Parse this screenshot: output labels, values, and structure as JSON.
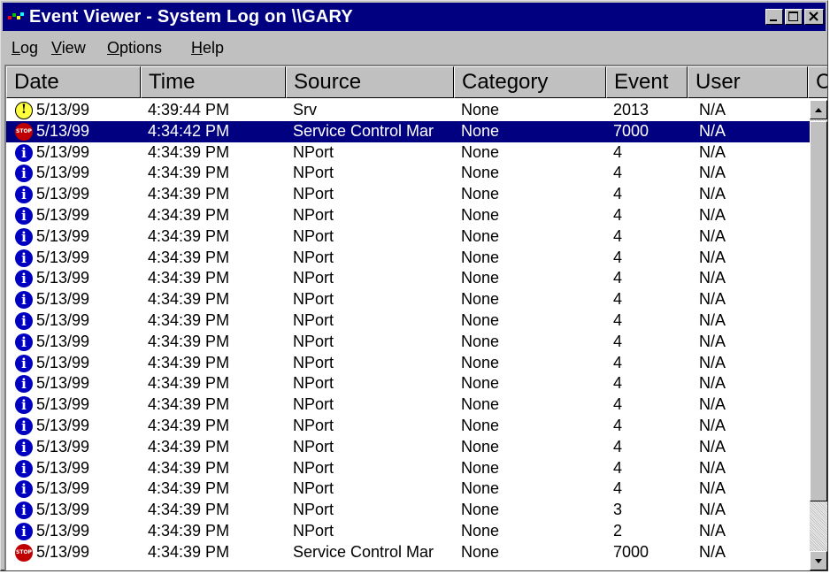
{
  "window": {
    "title": "Event Viewer - System Log on \\\\GARY"
  },
  "menu": [
    "Log",
    "View",
    "Options",
    "Help"
  ],
  "columns": [
    "Date",
    "Time",
    "Source",
    "Category",
    "Event",
    "User",
    "C"
  ],
  "rows": [
    {
      "icon": "warning-icon",
      "date": "5/13/99",
      "time": "4:39:44 PM",
      "source": "Srv",
      "category": "None",
      "event": "2013",
      "user": "N/A"
    },
    {
      "icon": "error-icon",
      "date": "5/13/99",
      "time": "4:34:42 PM",
      "source": "Service Control Mar",
      "category": "None",
      "event": "7000",
      "user": "N/A",
      "selected": true
    },
    {
      "icon": "info-icon",
      "date": "5/13/99",
      "time": "4:34:39 PM",
      "source": "NPort",
      "category": "None",
      "event": "4",
      "user": "N/A"
    },
    {
      "icon": "info-icon",
      "date": "5/13/99",
      "time": "4:34:39 PM",
      "source": "NPort",
      "category": "None",
      "event": "4",
      "user": "N/A"
    },
    {
      "icon": "info-icon",
      "date": "5/13/99",
      "time": "4:34:39 PM",
      "source": "NPort",
      "category": "None",
      "event": "4",
      "user": "N/A"
    },
    {
      "icon": "info-icon",
      "date": "5/13/99",
      "time": "4:34:39 PM",
      "source": "NPort",
      "category": "None",
      "event": "4",
      "user": "N/A"
    },
    {
      "icon": "info-icon",
      "date": "5/13/99",
      "time": "4:34:39 PM",
      "source": "NPort",
      "category": "None",
      "event": "4",
      "user": "N/A"
    },
    {
      "icon": "info-icon",
      "date": "5/13/99",
      "time": "4:34:39 PM",
      "source": "NPort",
      "category": "None",
      "event": "4",
      "user": "N/A"
    },
    {
      "icon": "info-icon",
      "date": "5/13/99",
      "time": "4:34:39 PM",
      "source": "NPort",
      "category": "None",
      "event": "4",
      "user": "N/A"
    },
    {
      "icon": "info-icon",
      "date": "5/13/99",
      "time": "4:34:39 PM",
      "source": "NPort",
      "category": "None",
      "event": "4",
      "user": "N/A"
    },
    {
      "icon": "info-icon",
      "date": "5/13/99",
      "time": "4:34:39 PM",
      "source": "NPort",
      "category": "None",
      "event": "4",
      "user": "N/A"
    },
    {
      "icon": "info-icon",
      "date": "5/13/99",
      "time": "4:34:39 PM",
      "source": "NPort",
      "category": "None",
      "event": "4",
      "user": "N/A"
    },
    {
      "icon": "info-icon",
      "date": "5/13/99",
      "time": "4:34:39 PM",
      "source": "NPort",
      "category": "None",
      "event": "4",
      "user": "N/A"
    },
    {
      "icon": "info-icon",
      "date": "5/13/99",
      "time": "4:34:39 PM",
      "source": "NPort",
      "category": "None",
      "event": "4",
      "user": "N/A"
    },
    {
      "icon": "info-icon",
      "date": "5/13/99",
      "time": "4:34:39 PM",
      "source": "NPort",
      "category": "None",
      "event": "4",
      "user": "N/A"
    },
    {
      "icon": "info-icon",
      "date": "5/13/99",
      "time": "4:34:39 PM",
      "source": "NPort",
      "category": "None",
      "event": "4",
      "user": "N/A"
    },
    {
      "icon": "info-icon",
      "date": "5/13/99",
      "time": "4:34:39 PM",
      "source": "NPort",
      "category": "None",
      "event": "4",
      "user": "N/A"
    },
    {
      "icon": "info-icon",
      "date": "5/13/99",
      "time": "4:34:39 PM",
      "source": "NPort",
      "category": "None",
      "event": "4",
      "user": "N/A"
    },
    {
      "icon": "info-icon",
      "date": "5/13/99",
      "time": "4:34:39 PM",
      "source": "NPort",
      "category": "None",
      "event": "4",
      "user": "N/A"
    },
    {
      "icon": "info-icon",
      "date": "5/13/99",
      "time": "4:34:39 PM",
      "source": "NPort",
      "category": "None",
      "event": "3",
      "user": "N/A"
    },
    {
      "icon": "info-icon",
      "date": "5/13/99",
      "time": "4:34:39 PM",
      "source": "NPort",
      "category": "None",
      "event": "2",
      "user": "N/A"
    },
    {
      "icon": "error-icon",
      "date": "5/13/99",
      "time": "4:34:39 PM",
      "source": "Service Control Mar",
      "category": "None",
      "event": "7000",
      "user": "N/A"
    }
  ],
  "colors": {
    "titlebar": "#000080",
    "selection": "#000080",
    "chrome": "#c0c0c0"
  }
}
